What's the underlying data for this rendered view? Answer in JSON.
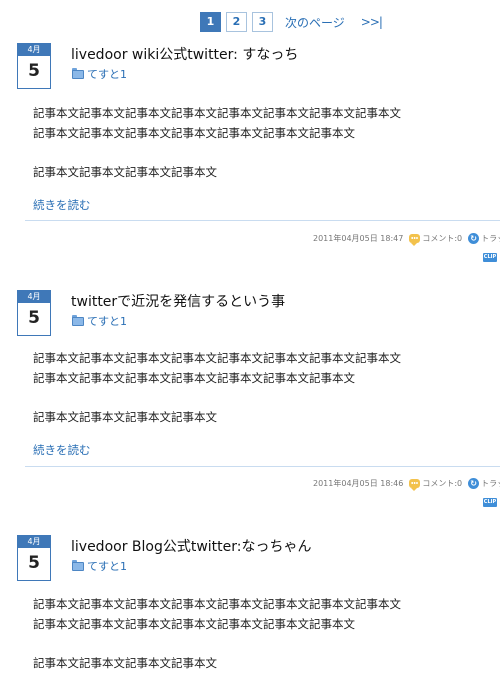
{
  "pagination": {
    "pages": [
      "1",
      "2",
      "3"
    ],
    "current": "1",
    "next_label": "次のページ",
    "last_label": ">>|"
  },
  "entries": [
    {
      "month": "4月",
      "day": "5",
      "title": "livedoor wiki公式twitter: すなっち",
      "category": "てすと1",
      "lines": [
        "記事本文記事本文記事本文記事本文記事本文記事本文記事本文記事本文",
        "記事本文記事本文記事本文記事本文記事本文記事本文記事本文",
        "記事本文記事本文記事本文記事本文"
      ],
      "read_more": "続きを読む",
      "datetime": "2011年04月05日 18:47",
      "comment": "コメント:0",
      "trackback": "トラッ",
      "clip": "CLIP"
    },
    {
      "month": "4月",
      "day": "5",
      "title": "twitterで近況を発信するという事",
      "category": "てすと1",
      "lines": [
        "記事本文記事本文記事本文記事本文記事本文記事本文記事本文記事本文",
        "記事本文記事本文記事本文記事本文記事本文記事本文記事本文",
        "記事本文記事本文記事本文記事本文"
      ],
      "read_more": "続きを読む",
      "datetime": "2011年04月05日 18:46",
      "comment": "コメント:0",
      "trackback": "トラッ",
      "clip": "CLIP"
    },
    {
      "month": "4月",
      "day": "5",
      "title": "livedoor Blog公式twitter:なっちゃん",
      "category": "てすと1",
      "lines": [
        "記事本文記事本文記事本文記事本文記事本文記事本文記事本文記事本文",
        "記事本文記事本文記事本文記事本文記事本文記事本文記事本文",
        "記事本文記事本文記事本文記事本文"
      ]
    }
  ]
}
